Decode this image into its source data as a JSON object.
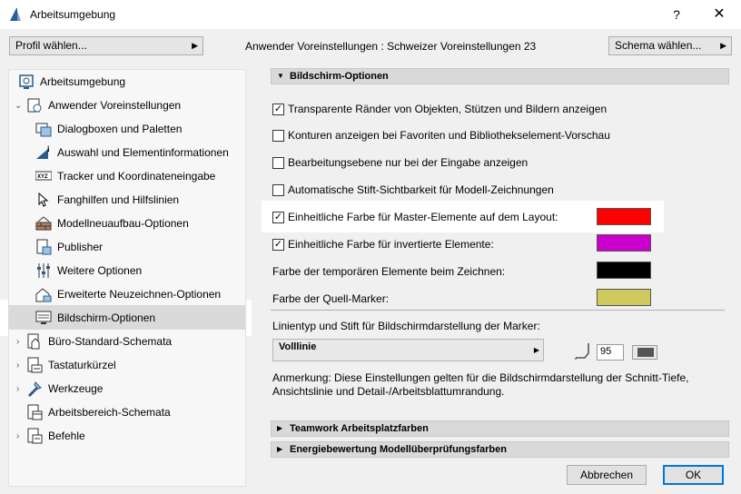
{
  "window": {
    "title": "Arbeitsumgebung",
    "help": "?",
    "close": "✕"
  },
  "toolbar": {
    "profile_button": "Profil wählen...",
    "user_prefs_label": "Anwender Voreinstellungen",
    "user_prefs_value": "Schweizer Voreinstellungen 23",
    "scheme_button": "Schema wählen..."
  },
  "sidebar": {
    "items": [
      {
        "label": "Arbeitsumgebung",
        "icon": "workspace-icon"
      },
      {
        "label": "Anwender Voreinstellungen",
        "icon": "user-prefs-icon"
      },
      {
        "label": "Dialogboxen und Paletten",
        "icon": "dialogs-icon"
      },
      {
        "label": "Auswahl und Elementinformationen",
        "icon": "selection-info-icon"
      },
      {
        "label": "Tracker und Koordinateneingabe",
        "icon": "tracker-xyz-icon"
      },
      {
        "label": "Fanghilfen und Hilfslinien",
        "icon": "snap-guides-icon"
      },
      {
        "label": "Modellneuaufbau-Optionen",
        "icon": "model-rebuild-icon"
      },
      {
        "label": "Publisher",
        "icon": "publisher-icon"
      },
      {
        "label": "Weitere Optionen",
        "icon": "more-options-icon"
      },
      {
        "label": "Erweiterte Neuzeichnen-Optionen",
        "icon": "redraw-options-icon"
      },
      {
        "label": "Bildschirm-Optionen",
        "icon": "screen-options-icon"
      },
      {
        "label": "Büro-Standard-Schemata",
        "icon": "office-schemes-icon"
      },
      {
        "label": "Tastaturkürzel",
        "icon": "keyboard-shortcuts-icon"
      },
      {
        "label": "Werkzeuge",
        "icon": "tools-icon"
      },
      {
        "label": "Arbeitsbereich-Schemata",
        "icon": "workspace-schemes-icon"
      },
      {
        "label": "Befehle",
        "icon": "commands-icon"
      }
    ]
  },
  "main": {
    "section_title": "Bildschirm-Optionen",
    "options": [
      {
        "label": "Transparente Ränder von Objekten, Stützen und Bildern anzeigen",
        "checked": true
      },
      {
        "label": "Konturen anzeigen bei Favoriten und Bibliothekselement-Vorschau",
        "checked": false
      },
      {
        "label": "Bearbeitungsebene nur bei der Eingabe anzeigen",
        "checked": false
      },
      {
        "label": "Automatische Stift-Sichtbarkeit für Modell-Zeichnungen",
        "checked": false
      },
      {
        "label": "Einheitliche Farbe für Master-Elemente auf dem Layout:",
        "checked": true,
        "color": "#ff0000"
      },
      {
        "label": "Einheitliche Farbe für invertierte Elemente:",
        "checked": true,
        "color": "#cc00cc"
      },
      {
        "label": "Farbe der temporären Elemente beim Zeichnen:",
        "color": "#000000"
      },
      {
        "label": "Farbe der Quell-Marker:",
        "color": "#cfc95e"
      }
    ],
    "marker_line_label": "Linientyp und Stift für Bildschirmdarstellung der Marker:",
    "line_type_value": "Volllinie",
    "pen_number": "95",
    "note": "Anmerkung: Diese Einstellungen gelten für die Bildschirmdarstellung der Schnitt-Tiefe, Ansichtslinie und Detail-/Arbeitsblattumrandung.",
    "collapsed_sections": [
      "Teamwork Arbeitsplatzfarben",
      "Energiebewertung Modellüberprüfungsfarben"
    ]
  },
  "buttons": {
    "cancel": "Abbrechen",
    "ok": "OK"
  }
}
